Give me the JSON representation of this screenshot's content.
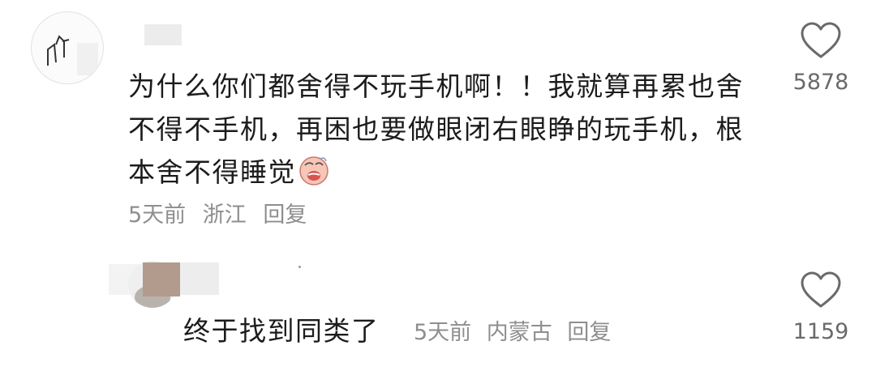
{
  "comments": [
    {
      "text": "为什么你们都舍得不玩手机啊！！我就算再累也舍不得不手机，再困也要做眼闭右眼睁的玩手机，根本舍不得睡觉",
      "time": "5天前",
      "location": "浙江",
      "reply_label": "回复",
      "likes": "5878",
      "emoji_icon": "crying-face-emoji"
    },
    {
      "text": "终于找到同类了",
      "time": "5天前",
      "location": "内蒙古",
      "reply_label": "回复",
      "likes": "1159"
    }
  ],
  "icons": {
    "like": "heart-outline-icon"
  },
  "colors": {
    "text": "#1c1c1c",
    "meta": "#8e8e8e",
    "icon": "#6a6a6a"
  }
}
